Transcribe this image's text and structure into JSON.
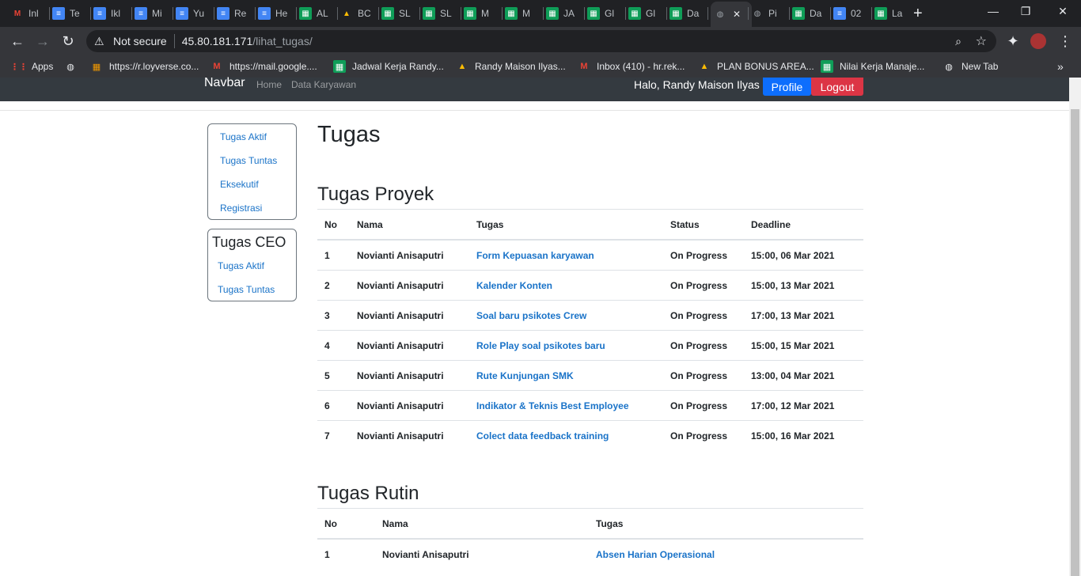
{
  "browser": {
    "tabs": [
      {
        "label": "Inl",
        "icon": "gmail-icon",
        "color": "#ea4335"
      },
      {
        "label": "Te",
        "icon": "docs-icon",
        "color": "#4285f4"
      },
      {
        "label": "Ikl",
        "icon": "docs-icon",
        "color": "#4285f4"
      },
      {
        "label": "Mi",
        "icon": "docs-icon",
        "color": "#4285f4"
      },
      {
        "label": "Yu",
        "icon": "docs-icon",
        "color": "#4285f4"
      },
      {
        "label": "Re",
        "icon": "docs-icon",
        "color": "#4285f4"
      },
      {
        "label": "He",
        "icon": "docs-icon",
        "color": "#4285f4"
      },
      {
        "label": "AL",
        "icon": "sheets-icon",
        "color": "#0f9d58"
      },
      {
        "label": "BC",
        "icon": "drive-icon",
        "color": "#fbbc04"
      },
      {
        "label": "SL",
        "icon": "sheets-icon",
        "color": "#0f9d58"
      },
      {
        "label": "SL",
        "icon": "sheets-icon",
        "color": "#0f9d58"
      },
      {
        "label": "M",
        "icon": "sheets-icon",
        "color": "#0f9d58"
      },
      {
        "label": "M",
        "icon": "sheets-icon",
        "color": "#0f9d58"
      },
      {
        "label": "JA",
        "icon": "sheets-icon",
        "color": "#0f9d58"
      },
      {
        "label": "Gl",
        "icon": "sheets-icon",
        "color": "#0f9d58"
      },
      {
        "label": "Gl",
        "icon": "sheets-icon",
        "color": "#0f9d58"
      },
      {
        "label": "Da",
        "icon": "sheets-icon",
        "color": "#0f9d58"
      },
      {
        "label": "",
        "icon": "globe-icon",
        "color": "#9aa0a6",
        "active": true
      },
      {
        "label": "Pi",
        "icon": "globe-icon",
        "color": "#9aa0a6"
      },
      {
        "label": "Da",
        "icon": "sheets-icon",
        "color": "#0f9d58"
      },
      {
        "label": "02",
        "icon": "docs-icon",
        "color": "#4285f4"
      },
      {
        "label": "La",
        "icon": "sheets-icon",
        "color": "#0f9d58"
      }
    ],
    "new_tab": "+",
    "minimize": "—",
    "restore": "❐",
    "close": "✕",
    "security": "Not secure",
    "url_host": "45.80.181.171",
    "url_path": "/lihat_tugas/",
    "bookmarks": [
      {
        "label": "Apps",
        "icon": "apps-icon"
      },
      {
        "label": "",
        "icon": "globe-icon"
      },
      {
        "label": "https://r.loyverse.co...",
        "icon": "loyverse-icon"
      },
      {
        "label": "https://mail.google....",
        "icon": "gmail-icon"
      },
      {
        "label": "Jadwal Kerja Randy...",
        "icon": "sheets-icon"
      },
      {
        "label": "Randy Maison Ilyas...",
        "icon": "drive-icon"
      },
      {
        "label": "Inbox (410) - hr.rek...",
        "icon": "gmail-icon"
      },
      {
        "label": "PLAN BONUS AREA...",
        "icon": "drive-icon"
      },
      {
        "label": "Nilai Kerja Manaje...",
        "icon": "sheets-icon"
      },
      {
        "label": "New Tab",
        "icon": "globe-icon"
      }
    ],
    "more_bookmarks": "»"
  },
  "navbar": {
    "brand": "Navbar",
    "links": [
      "Home",
      "Data Karyawan"
    ],
    "greeting": "Halo, Randy Maison Ilyas",
    "profile_label": "Profile",
    "logout_label": "Logout",
    "profile_color": "#0d6efd",
    "logout_color": "#dc3545"
  },
  "sidebar": {
    "menu1": [
      "Tugas Aktif",
      "Tugas Tuntas",
      "Eksekutif",
      "Registrasi"
    ],
    "menu2_title": "Tugas CEO",
    "menu2": [
      "Tugas Aktif",
      "Tugas Tuntas"
    ]
  },
  "main": {
    "title": "Tugas",
    "proyek": {
      "title": "Tugas Proyek",
      "headers": [
        "No",
        "Nama",
        "Tugas",
        "Status",
        "Deadline"
      ],
      "rows": [
        [
          "1",
          "Novianti Anisaputri",
          "Form Kepuasan karyawan",
          "On Progress",
          "15:00, 06 Mar 2021"
        ],
        [
          "2",
          "Novianti Anisaputri",
          "Kalender Konten",
          "On Progress",
          "15:00, 13 Mar 2021"
        ],
        [
          "3",
          "Novianti Anisaputri",
          "Soal baru psikotes Crew",
          "On Progress",
          "17:00, 13 Mar 2021"
        ],
        [
          "4",
          "Novianti Anisaputri",
          "Role Play soal psikotes baru",
          "On Progress",
          "15:00, 15 Mar 2021"
        ],
        [
          "5",
          "Novianti Anisaputri",
          "Rute Kunjungan SMK",
          "On Progress",
          "13:00, 04 Mar 2021"
        ],
        [
          "6",
          "Novianti Anisaputri",
          "Indikator & Teknis Best Employee",
          "On Progress",
          "17:00, 12 Mar 2021"
        ],
        [
          "7",
          "Novianti Anisaputri",
          "Colect data feedback training",
          "On Progress",
          "15:00, 16 Mar 2021"
        ]
      ]
    },
    "rutin": {
      "title": "Tugas Rutin",
      "headers": [
        "No",
        "Nama",
        "Tugas"
      ],
      "rows": [
        [
          "1",
          "Novianti Anisaputri",
          "Absen Harian Operasional"
        ]
      ]
    }
  }
}
